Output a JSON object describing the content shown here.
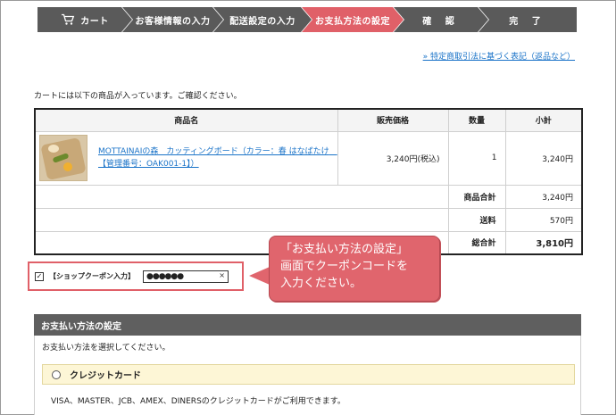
{
  "steps": [
    {
      "label": "カート",
      "icon": "cart-icon"
    },
    {
      "label": "お客様情報の入力"
    },
    {
      "label": "配送設定の入力"
    },
    {
      "label": "お支払方法の設定",
      "active": true
    },
    {
      "label": "確 認"
    },
    {
      "label": "完 了"
    }
  ],
  "colors": {
    "step_bg": "#5a5a5a",
    "step_active": "#e06068",
    "link": "#1a73c8",
    "bubble": "#e0656d",
    "option_bg": "#fdf6d6"
  },
  "law_link": "» 特定商取引法に基づく表記（返品など）",
  "intro": "カートには以下の商品が入っています。ご確認ください。",
  "cart": {
    "headers": [
      "商品名",
      "販売価格",
      "数量",
      "小計"
    ],
    "item": {
      "name": "MOTTAINAIの森　カッティングボード（カラー：春 はなばたけ　【管理番号：OAK001-1】）",
      "price": "3,240円(税込)",
      "qty": "1",
      "subtotal": "3,240円"
    },
    "summary": [
      {
        "label": "商品合計",
        "value": "3,240円"
      },
      {
        "label": "送料",
        "value": "570円"
      },
      {
        "label": "総合計",
        "value": "3,810円"
      }
    ]
  },
  "coupon": {
    "checkbox_mark": "✓",
    "label": "【ショップクーポン入力】",
    "value": "●●●●●●",
    "clear": "×"
  },
  "bubble": {
    "line1": "「お支払い方法の設定」",
    "line2": "画面でクーポンコードを",
    "line3": "入力ください。"
  },
  "payment": {
    "header": "お支払い方法の設定",
    "instruction": "お支払い方法を選択してください。",
    "option_label": "クレジットカード",
    "note": "VISA、MASTER、JCB、AMEX、DINERSのクレジットカードがご利用できます。"
  }
}
